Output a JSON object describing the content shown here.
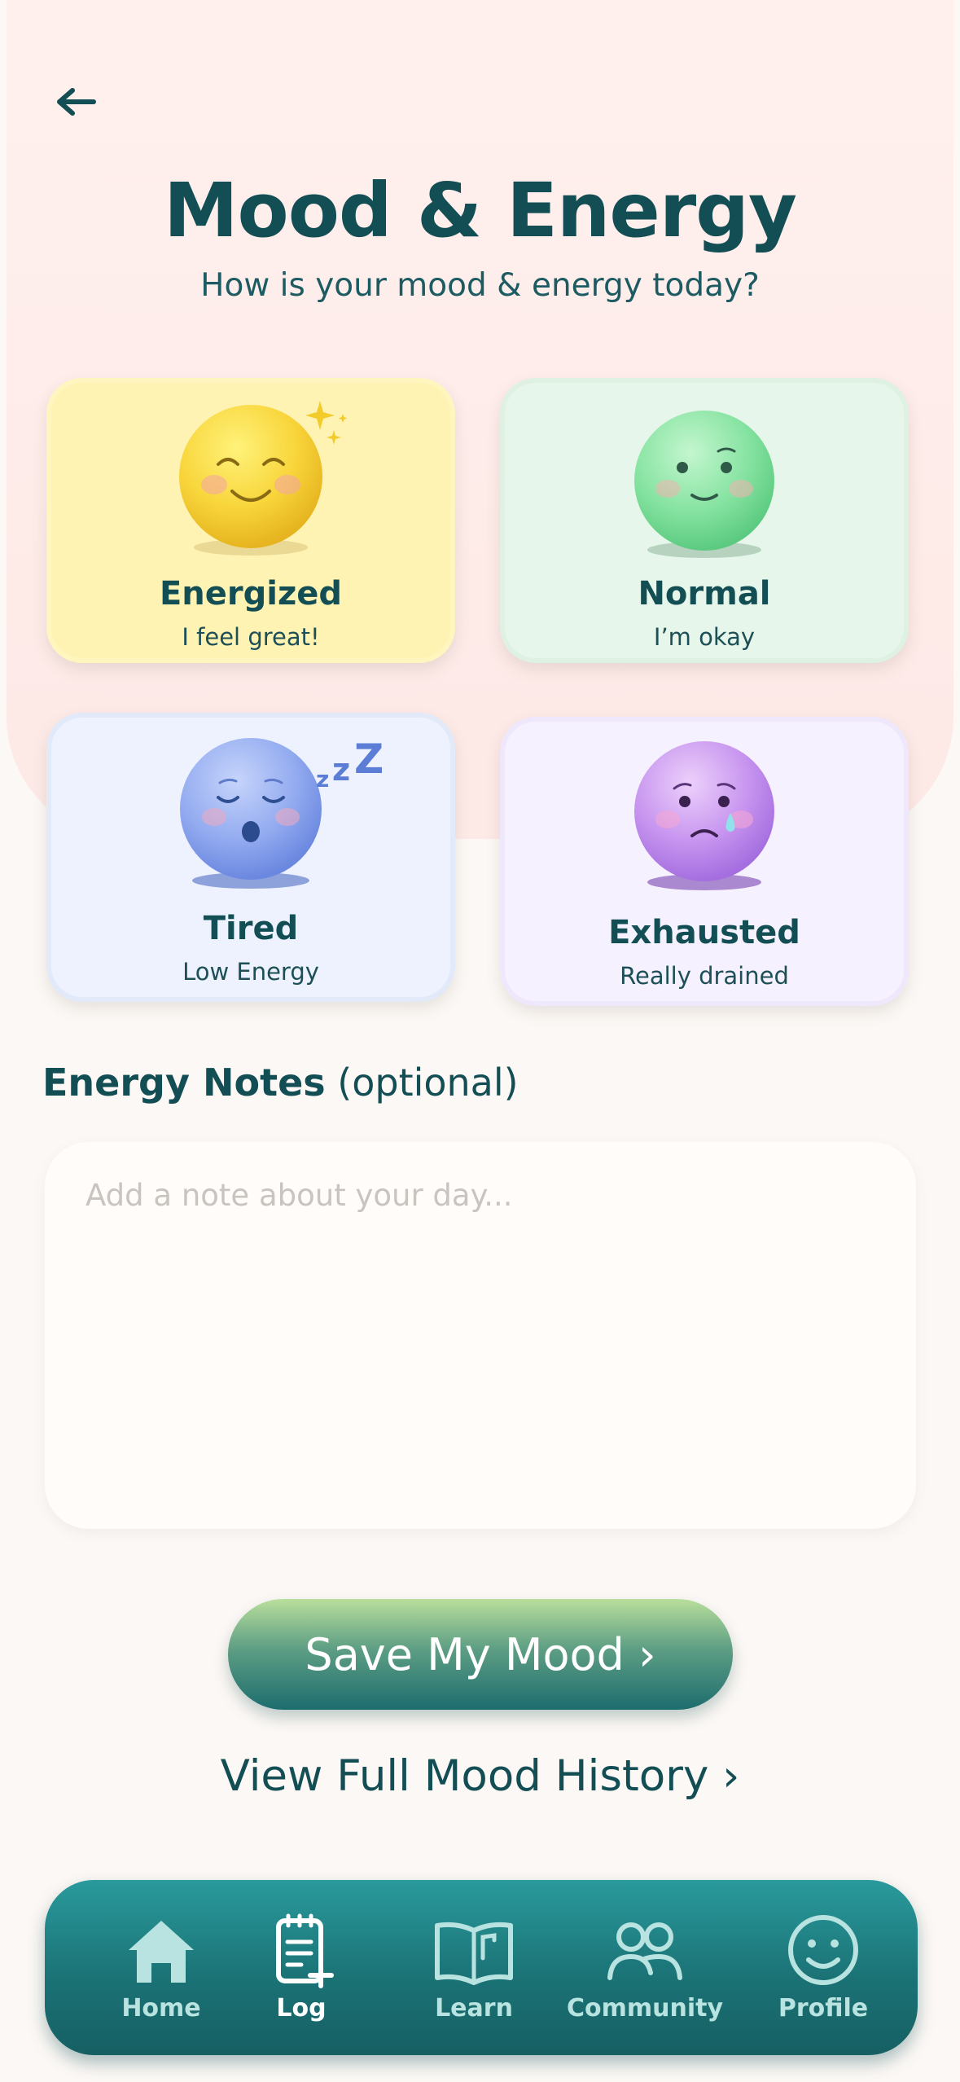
{
  "header": {
    "title": "Mood & Energy",
    "subtitle": "How is your mood & energy today?"
  },
  "moods": [
    {
      "name": "Energized",
      "desc": "I feel great!"
    },
    {
      "name": "Normal",
      "desc": "I’m okay"
    },
    {
      "name": "Tired",
      "desc": "Low Energy"
    },
    {
      "name": "Exhausted",
      "desc": "Really drained"
    }
  ],
  "notes": {
    "label_bold": "Energy Notes",
    "label_rest": " (optional)",
    "placeholder": "Add a note about your day...",
    "value": ""
  },
  "actions": {
    "save": "Save My Mood ›",
    "history": "View Full Mood History ›"
  },
  "nav": {
    "items": [
      {
        "label": "Home",
        "icon": "home-icon"
      },
      {
        "label": "Log",
        "icon": "log-icon"
      },
      {
        "label": "Learn",
        "icon": "book-icon"
      },
      {
        "label": "Community",
        "icon": "people-icon"
      },
      {
        "label": "Profile",
        "icon": "smiley-icon"
      }
    ],
    "active": "Log"
  },
  "colors": {
    "primary": "#134e55",
    "energized": "#fff3b4",
    "normal": "#e7f6ea",
    "tired": "#edf2fe",
    "exhausted": "#f6f1fe",
    "nav": "#1b7376"
  }
}
